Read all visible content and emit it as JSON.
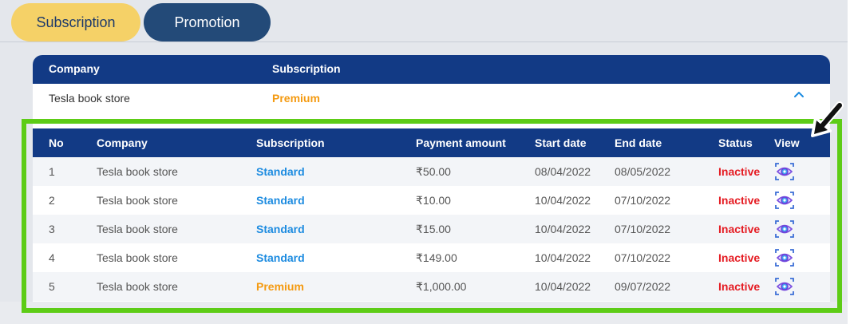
{
  "tabs": [
    {
      "label": "Subscription"
    },
    {
      "label": "Promotion"
    }
  ],
  "summary": {
    "headers": {
      "company": "Company",
      "subscription": "Subscription"
    },
    "row": {
      "company": "Tesla book store",
      "subscription": "Premium"
    }
  },
  "details": {
    "headers": {
      "no": "No",
      "company": "Company",
      "subscription": "Subscription",
      "payment": "Payment amount",
      "start": "Start date",
      "end": "End date",
      "status": "Status",
      "view": "View"
    },
    "rows": [
      {
        "no": "1",
        "company": "Tesla book store",
        "subscription": "Standard",
        "payment": "₹50.00",
        "start": "08/04/2022",
        "end": "08/05/2022",
        "status": "Inactive"
      },
      {
        "no": "2",
        "company": "Tesla book store",
        "subscription": "Standard",
        "payment": "₹10.00",
        "start": "10/04/2022",
        "end": "07/10/2022",
        "status": "Inactive"
      },
      {
        "no": "3",
        "company": "Tesla book store",
        "subscription": "Standard",
        "payment": "₹15.00",
        "start": "10/04/2022",
        "end": "07/10/2022",
        "status": "Inactive"
      },
      {
        "no": "4",
        "company": "Tesla book store",
        "subscription": "Standard",
        "payment": "₹149.00",
        "start": "10/04/2022",
        "end": "07/10/2022",
        "status": "Inactive"
      },
      {
        "no": "5",
        "company": "Tesla book store",
        "subscription": "Premium",
        "payment": "₹1,000.00",
        "start": "10/04/2022",
        "end": "09/07/2022",
        "status": "Inactive"
      }
    ]
  },
  "icons": {
    "collapse": "chevron-up-icon",
    "view": "eye-scan-icon",
    "annotation": "arrow-pointer-icon"
  },
  "colors": {
    "navy": "#123a85",
    "tab_active": "#f5d167",
    "tab_inactive": "#234a78",
    "standard": "#1c8be0",
    "premium": "#f49a11",
    "inactive": "#e51c23",
    "highlight": "#5dcc16"
  }
}
